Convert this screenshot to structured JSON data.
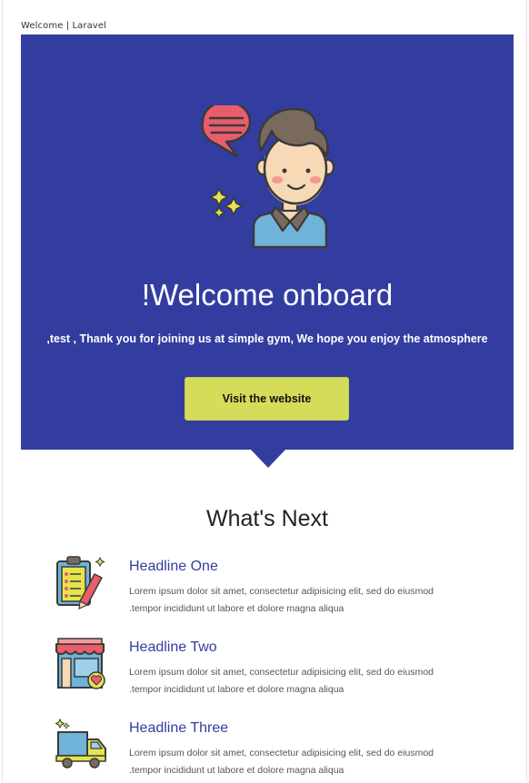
{
  "document": {
    "tab_title": "Welcome | Laravel"
  },
  "hero": {
    "title": "!Welcome onboard",
    "message": ",test , Thank you for joining us at simple gym, We hope you enjoy the atmosphere",
    "cta_label": "Visit the website",
    "background_color": "#333da0",
    "cta_color": "#d5dc5a",
    "illustration": "person-with-speech-bubble-icon"
  },
  "whats_next": {
    "title": "What's Next",
    "items": [
      {
        "heading": "Headline One",
        "line1": "Lorem ipsum dolor sit amet, consectetur adipisicing elit, sed do eiusmod",
        "line2": ".tempor incididunt ut labore et dolore magna aliqua",
        "icon": "clipboard-checklist-icon"
      },
      {
        "heading": "Headline Two",
        "line1": "Lorem ipsum dolor sit amet, consectetur adipisicing elit, sed do eiusmod",
        "line2": ".tempor incididunt ut labore et dolore magna aliqua",
        "icon": "storefront-heart-icon"
      },
      {
        "heading": "Headline Three",
        "line1": "Lorem ipsum dolor sit amet, consectetur adipisicing elit, sed do eiusmod",
        "line2": ".tempor incididunt ut labore et dolore magna aliqua",
        "icon": "delivery-truck-icon"
      }
    ]
  }
}
